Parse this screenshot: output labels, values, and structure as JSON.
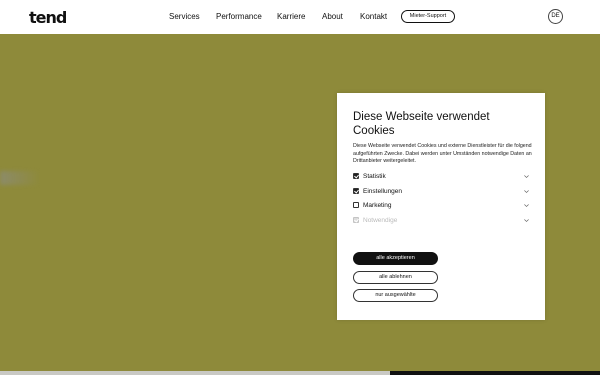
{
  "header": {
    "logo": "tend",
    "nav": [
      "Services",
      "Performance",
      "Karriere",
      "About",
      "Kontakt"
    ],
    "support_button": "Mieter-Support",
    "language": "DE"
  },
  "colors": {
    "background": "#8e8a3a",
    "header": "#ffffff",
    "dialog": "#ffffff",
    "primary_button": "#111111"
  },
  "cookie_dialog": {
    "title": "Diese Webseite verwendet Cookies",
    "description": "Diese Webseite verwendet Cookies und externe Dienstleister für die folgend aufgeführten Zwecke. Dabei werden unter Umständen notwendige Daten an Drittanbieter weitergeleitet.",
    "options": [
      {
        "label": "Statistik",
        "checked": true,
        "disabled": false,
        "icon": "chevron-down-icon"
      },
      {
        "label": "Einstellungen",
        "checked": true,
        "disabled": false,
        "icon": "chevron-down-icon"
      },
      {
        "label": "Marketing",
        "checked": false,
        "disabled": false,
        "icon": "chevron-down-icon"
      },
      {
        "label": "Notwendige",
        "checked": true,
        "disabled": true,
        "icon": "chevron-down-icon"
      }
    ],
    "buttons": {
      "accept_all": "alle akzeptieren",
      "reject_all": "alle ablehnen",
      "accept_selected": "nur ausgewählte"
    }
  }
}
